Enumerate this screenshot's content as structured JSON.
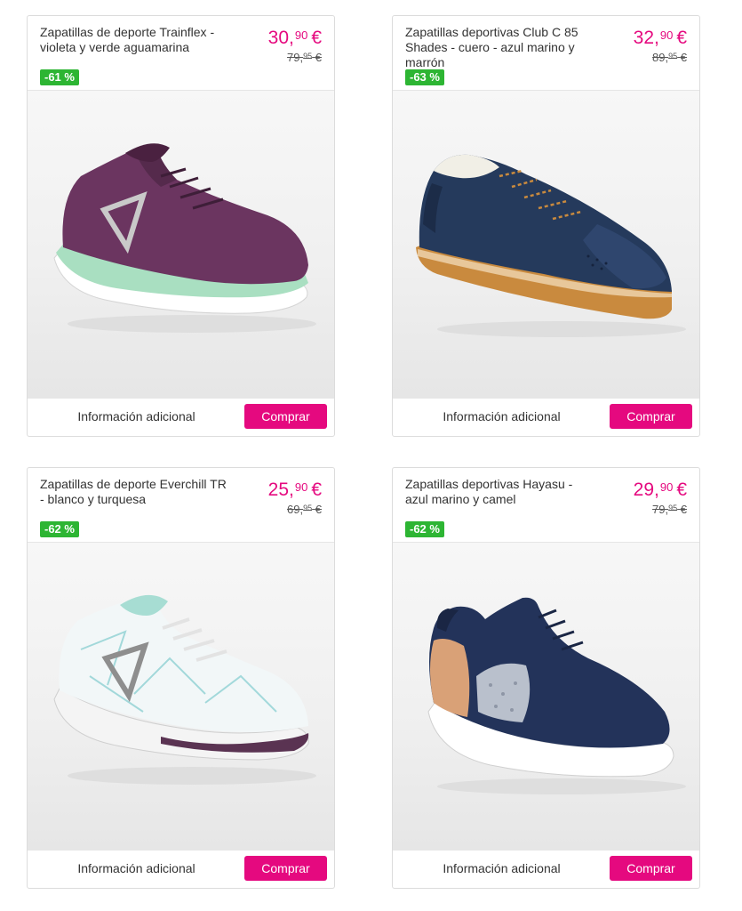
{
  "products": [
    {
      "title": "Zapatillas de deporte Trainflex - violeta y verde aguamarina",
      "price_int": "30,",
      "price_dec": "90",
      "currency": "€",
      "old_int": "79,",
      "old_dec": "95",
      "old_currency": "€",
      "discount": "-61 %",
      "info_label": "Información adicional",
      "buy_label": "Comprar",
      "image": "shoe-purple-mint"
    },
    {
      "title": "Zapatillas deportivas Club C 85 Shades - cuero - azul marino y marrón",
      "price_int": "32,",
      "price_dec": "90",
      "currency": "€",
      "old_int": "89,",
      "old_dec": "95",
      "old_currency": "€",
      "discount": "-63 %",
      "info_label": "Información adicional",
      "buy_label": "Comprar",
      "image": "shoe-navy-gum"
    },
    {
      "title": "Zapatillas de deporte Everchill TR - blanco y turquesa",
      "price_int": "25,",
      "price_dec": "90",
      "currency": "€",
      "old_int": "69,",
      "old_dec": "95",
      "old_currency": "€",
      "discount": "-62 %",
      "info_label": "Información adicional",
      "buy_label": "Comprar",
      "image": "shoe-white-turquoise"
    },
    {
      "title": "Zapatillas deportivas Hayasu - azul marino y camel",
      "price_int": "29,",
      "price_dec": "90",
      "currency": "€",
      "old_int": "79,",
      "old_dec": "95",
      "old_currency": "€",
      "discount": "-62 %",
      "info_label": "Información adicional",
      "buy_label": "Comprar",
      "image": "shoe-navy-camel"
    }
  ],
  "colors": {
    "accent": "#e5097f",
    "discount_badge": "#2db533",
    "border": "#dcdcdc"
  }
}
